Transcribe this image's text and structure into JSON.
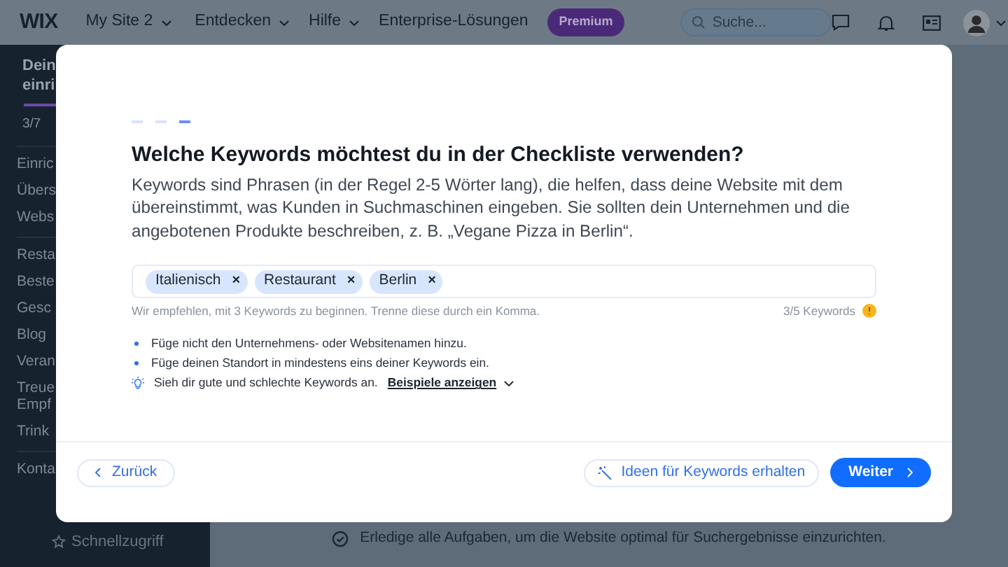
{
  "topbar": {
    "logo": "WIX",
    "site_menu": "My Site 2",
    "nav": [
      "Entdecken",
      "Hilfe"
    ],
    "enterprise": "Enterprise-Lösungen",
    "premium": "Premium",
    "search": {
      "placeholder": "Suche..."
    }
  },
  "sidebar": {
    "title_lines": [
      "Dein",
      "einri"
    ],
    "progress": {
      "level": 0.43
    },
    "progress_text": "3/7",
    "groups": [
      [
        "Einric",
        "Übers",
        "Webs"
      ],
      [
        "Resta",
        "Beste",
        "Gesc",
        "Blog",
        "Veran",
        "Treue Empf",
        "Trink"
      ],
      [
        "Konta"
      ]
    ],
    "quick_access": "Schnellzugriff"
  },
  "modal": {
    "steps": [
      {
        "selected": false
      },
      {
        "selected": false
      },
      {
        "selected": true
      }
    ],
    "title": "Welche Keywords möchtest du in der Checkliste verwenden?",
    "description": "Keywords sind Phrasen (in der Regel 2-5 Wörter lang), die helfen, dass deine Website mit dem übereinstimmt, was Kunden in Suchmaschinen eingeben. Sie sollten dein Unternehmen und die angebotenen Produkte beschreiben, z. B. „Vegane Pizza in Berlin“.",
    "keywords": [
      {
        "label": "Italienisch",
        "remove": "×"
      },
      {
        "label": "Restaurant",
        "remove": "×"
      },
      {
        "label": "Berlin",
        "remove": "×"
      }
    ],
    "hint": "Wir empfehlen, mit 3 Keywords zu beginnen. Trenne diese durch ein Komma.",
    "count": "3/5 Keywords",
    "tips": [
      {
        "kind": "bullet",
        "text": "Füge nicht den Unternehmens- oder Websitenamen hinzu."
      },
      {
        "kind": "bullet",
        "text": "Füge deinen Standort in mindestens eins deiner Keywords ein."
      },
      {
        "kind": "idea",
        "text": "Sieh dir gute und schlechte Keywords an.",
        "link": "Beispiele anzeigen"
      }
    ],
    "back": "Zurück",
    "ideas": "Ideen für Keywords erhalten",
    "next": "Weiter"
  },
  "status_text": "Erledige alle Aufgaben, um die Website optimal für Suchergebnisse einzurichten."
}
